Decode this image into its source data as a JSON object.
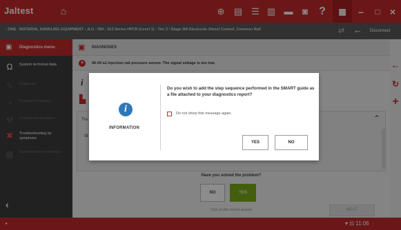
{
  "app": {
    "logo": "Jaltest",
    "logo_sub": "",
    "home_icon": "home-icon"
  },
  "toolbar": {
    "icons": [
      "target-icon",
      "document-icon",
      "list-icon",
      "print-icon",
      "truck-icon",
      "camera-icon",
      "help-icon"
    ],
    "help_label": "?",
    "window": {
      "grid": "▦",
      "minimize": "–",
      "maximize": "□",
      "close": "×"
    }
  },
  "breadcrumb": {
    "text": "‹ OHE · MATERIAL HANDLING EQUIPMENT › JLG › ISH › 313 Series HPCR (Level 1) - Tier 2 / Stage IIIA Electronic Diesel Control, Common Rail",
    "back_label": "Disconnect"
  },
  "sidebar": {
    "header_label": "Diagnostics menu",
    "items": [
      {
        "label": "System technical data",
        "state": "active",
        "icon": "omega-icon"
      },
      {
        "label": "Diagnosis",
        "state": "dim",
        "icon": "wrench-icon"
      },
      {
        "label": "Parameters/values",
        "state": "dim",
        "icon": "gauge-icon"
      },
      {
        "label": "Component locations",
        "state": "dim",
        "icon": "tool-icon"
      },
      {
        "label": "Troubleshooting by symptoms",
        "state": "active",
        "icon": "troubleshoot-icon"
      },
      {
        "label": "Maintenance instructions",
        "state": "dim",
        "icon": "manual-icon"
      }
    ],
    "collapse": "‹"
  },
  "main": {
    "header_label": "DIAGNOSES",
    "fault_text": "96-04 a1 Injection rail pressure sensor. The signal voltage is too low.",
    "info_i": "i",
    "step_header": "Tru",
    "step_text": "St",
    "solved_question": "Have you solved the problem?",
    "no_label": "NO",
    "yes_label": "YES",
    "click_hint": "Click on the correct answer",
    "next_label": "NEXT"
  },
  "right_tools": [
    "←",
    "↻",
    "+"
  ],
  "bottom": {
    "left": "▸",
    "right": "▾  ⊡  11:06"
  },
  "dialog": {
    "title": "INFORMATION",
    "icon_glyph": "i",
    "question": "Do you wish to add the step sequence performed in the SMART guide as a file attached to your diagnostics report?",
    "checkbox_label": "Do not show this message again.",
    "yes_label": "YES",
    "no_label": "NO"
  },
  "colors": {
    "brand_red": "#c52b2b",
    "info_blue": "#2f78b7",
    "yes_green": "#7bab17",
    "sidebar_bg": "#3d3d3d"
  }
}
